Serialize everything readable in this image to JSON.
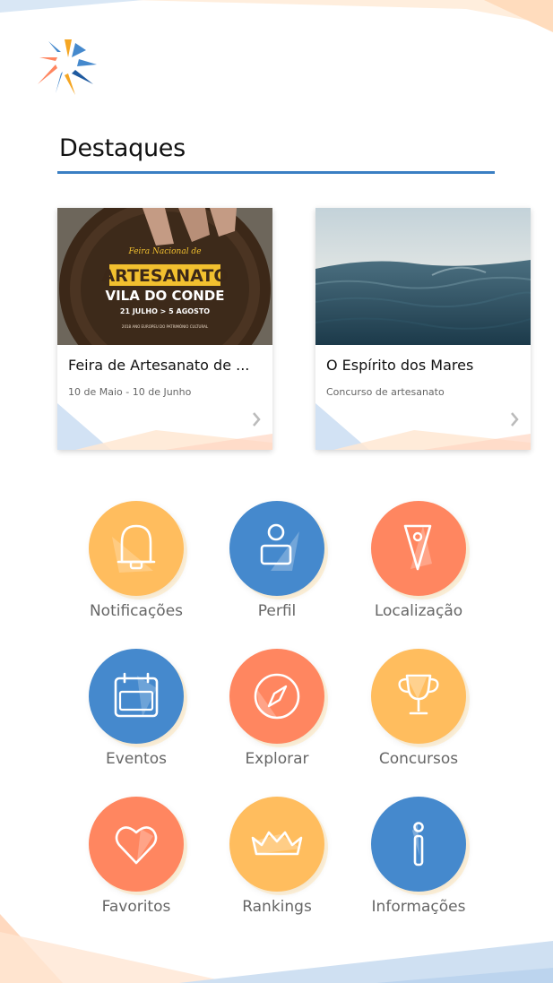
{
  "section": {
    "title": "Destaques"
  },
  "cards": [
    {
      "title": "Feira de Artesanato de ...",
      "subtitle": "10 de Maio - 10 de Junho",
      "poster": {
        "line1": "Feira Nacional de",
        "line2": "ARTESANATO",
        "line3": "VILA DO CONDE",
        "line4": "21 JULHO > 5 AGOSTO",
        "line5": "2018 ANO EUROPEU DO PATRIMÓNIO CULTURAL"
      }
    },
    {
      "title": "O Espírito dos Mares",
      "subtitle": "Concurso de artesanato"
    }
  ],
  "menu": [
    {
      "label": "Notificações",
      "icon": "bell-icon",
      "color": "orange"
    },
    {
      "label": "Perfil",
      "icon": "user-icon",
      "color": "blue"
    },
    {
      "label": "Localização",
      "icon": "location-pin-icon",
      "color": "red"
    },
    {
      "label": "Eventos",
      "icon": "calendar-icon",
      "color": "blue"
    },
    {
      "label": "Explorar",
      "icon": "compass-icon",
      "color": "red"
    },
    {
      "label": "Concursos",
      "icon": "trophy-icon",
      "color": "orange"
    },
    {
      "label": "Favoritos",
      "icon": "heart-icon",
      "color": "red"
    },
    {
      "label": "Rankings",
      "icon": "crown-icon",
      "color": "orange"
    },
    {
      "label": "Informações",
      "icon": "info-icon",
      "color": "blue"
    }
  ],
  "colors": {
    "accent_blue": "#4589cd",
    "accent_orange": "#ffbd5e",
    "accent_red": "#ff8660",
    "rule": "#3a7fc3"
  }
}
